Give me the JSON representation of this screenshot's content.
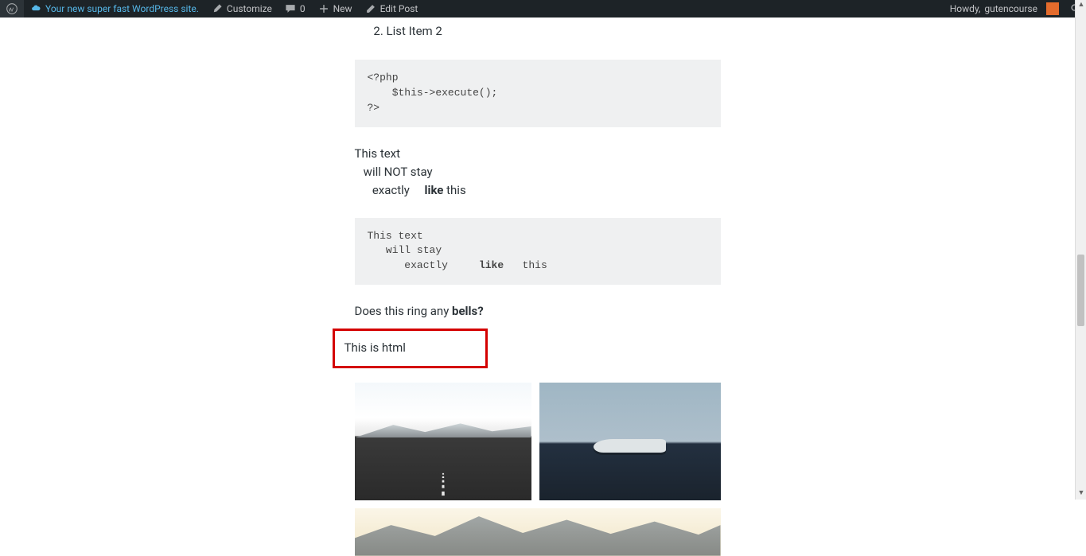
{
  "adminbar": {
    "site_title": "Your new super fast WordPress site.",
    "customize": "Customize",
    "comments_count": "0",
    "new": "New",
    "edit_post": "Edit Post",
    "howdy_prefix": "Howdy, ",
    "username": "gutencourse"
  },
  "content": {
    "list_items": [
      "List Item 2"
    ],
    "list_start": 2,
    "code1_l1": "<?php",
    "code1_l2": "    $this->execute();",
    "code1_l3": "?>",
    "para1_l1": "This text",
    "para1_l2a": "will NOT stay",
    "para1_l3_a": "exactly",
    "para1_l3_b": "like",
    "para1_l3_c": " this",
    "code2_l1": "This text",
    "code2_l2": "   will stay",
    "code2_l3_a": "      exactly     ",
    "code2_l3_b": "like",
    "code2_l3_c": "   this",
    "para2_a": "Does this ring any ",
    "para2_b": "bells?",
    "html_text": "This is html"
  }
}
